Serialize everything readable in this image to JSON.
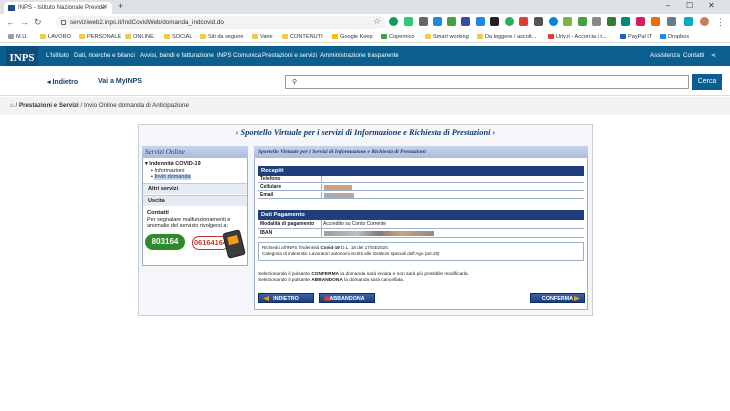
{
  "browser": {
    "tab_title": "INPS - Istituto Nazionale Previde",
    "url": "serviziweb2.inps.it/IndCovidWeb/domanda_indcovid.do",
    "bookmarks": [
      "M.U.",
      "LAVORO",
      "PERSONALE",
      "ONLINE",
      "SOCIAL",
      "Siti da seguire",
      "Varie",
      "CONTENUTI",
      "Google Keep",
      "Copernico",
      "Smart working",
      "Da leggere / ascolt...",
      "Urly.it - Accorcia i t...",
      "PayPal IT",
      "Dropbox"
    ]
  },
  "site": {
    "logo": "INPS",
    "nav": [
      "L'Istituto",
      "Dati, ricerche e bilanci",
      "Avvisi, bandi e fatturazione",
      "INPS Comunica",
      "Prestazioni e servizi",
      "Amministrazione trasparente"
    ],
    "assistenza": "Assistenza",
    "contatti": "Contatti",
    "indietro": "Indietro",
    "vai_myinps": "Vai a MyINPS",
    "cerca": "Cerca",
    "breadcrumb": {
      "home": "⌂",
      "section": "Prestazioni e Servizi",
      "current": "Invio Online domanda di Anticipazione"
    }
  },
  "panel": {
    "title": "‹ Sportello Virtuale per i servizi di Informazione e Richiesta di Prestazioni ›",
    "sidebar": {
      "header": "Servizi Online",
      "group": "▾ Indennità COVID-19",
      "items": [
        "Informazioni",
        "Invio domanda"
      ],
      "altri": "Altri servizi",
      "uscita": "Uscita",
      "contatti_title": "Contatti",
      "contatti_text1": "Per segnalare malfunzionamenti e",
      "contatti_text2": "anomalie del servizio rivolgersi a:",
      "phone1": "803164",
      "phone2": "06164164"
    },
    "content": {
      "header": "Sportello Virtuale per i Servizi di Informazione e Richiesta di Prestazioni",
      "recapiti_title": "Recapiti",
      "recapiti": [
        {
          "label": "Telefono",
          "value": ""
        },
        {
          "label": "Cellulare",
          "value": ""
        },
        {
          "label": "Email",
          "value": ""
        }
      ],
      "pagamento_title": "Dati Pagamento",
      "pagamento": [
        {
          "label": "Modalità di pagamento",
          "value": "Accredito su Conto Corrente"
        },
        {
          "label": "IBAN",
          "value": ""
        }
      ],
      "note_line1_a": "Richiedo all'INPS l'indennità ",
      "note_line1_b": "Covid-19",
      "note_line1_c": " D.L. 18 del 17/03/2020.",
      "note_line2": "Categoria di indennità: Lavoratori autonomi iscritti alle Gestioni speciali dell'Ago (art.28)",
      "info1_a": "Selezionando il pulsante ",
      "info1_b": "CONFERMA",
      "info1_c": " la domanda sarà inviata e non sarà più possibile modificarla.",
      "info2_a": "Selezionando il pulsante ",
      "info2_b": "ABBANDONA",
      "info2_c": " la domanda sarà cancellata.",
      "btn_indietro": "INDIETRO",
      "btn_abbandona": "ABBANDONA",
      "btn_conferma": "CONFERMA"
    }
  },
  "colors": {
    "inps_blue": "#0b5f8f",
    "section_navy": "#1f3f7a",
    "phone_green": "#2e8a2c",
    "phone_red": "#c0392b"
  }
}
